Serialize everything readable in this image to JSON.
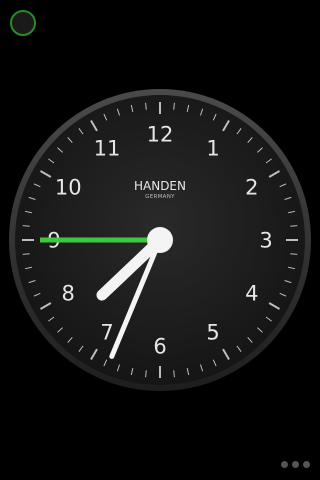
{
  "clock": {
    "brand": "HANDEN",
    "subbrand": "GERMANY",
    "numerals": [
      "12",
      "1",
      "2",
      "3",
      "4",
      "5",
      "6",
      "7",
      "8",
      "9",
      "10",
      "11"
    ],
    "time": {
      "hour": 7,
      "minute": 33,
      "second": 45
    },
    "colors": {
      "dial": "#1f1f1f",
      "bezel": "#3a3a3a",
      "hands": "#f4f4f4",
      "second_hand": "#3ec83e",
      "ticks": "#bdbdbd"
    }
  },
  "menu_button": {
    "icon": "circle-menu-icon",
    "color": "#2a8a2a"
  },
  "page_indicator": {
    "count": 3,
    "current": 3
  }
}
